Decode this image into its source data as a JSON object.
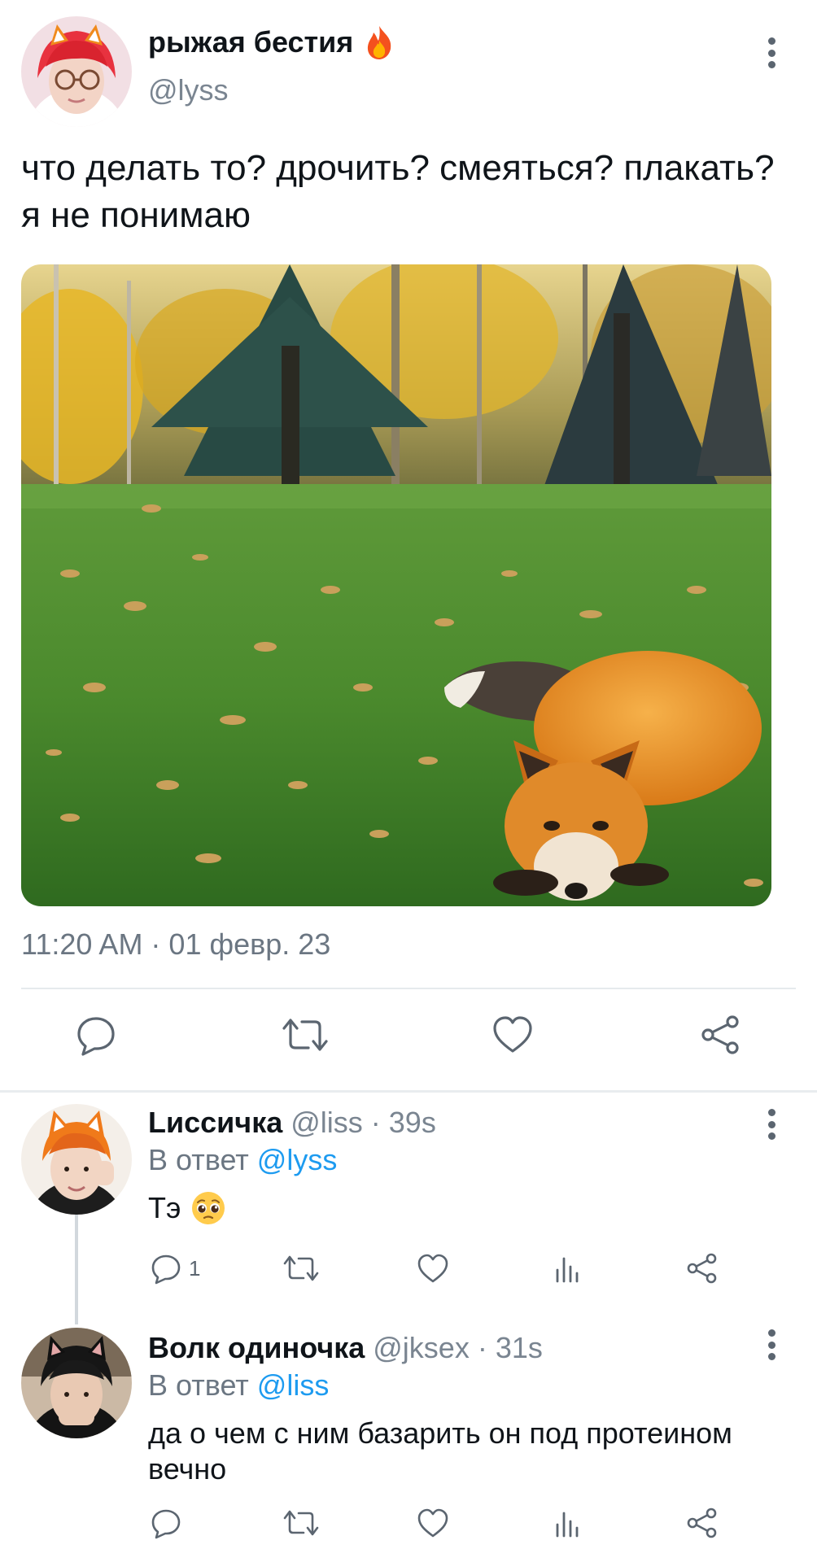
{
  "main_tweet": {
    "author_name": "рыжая бестия",
    "author_handle": "@lyss",
    "text": "что делать то? дрочить? смеяться? плакать? я не понимаю",
    "timestamp": "11:20 AM · 01 февр. 23",
    "icons": {
      "name_emoji": "fire-icon",
      "more": "more-vertical-icon",
      "reply": "reply-icon",
      "retweet": "retweet-icon",
      "like": "heart-icon",
      "share": "share-icon"
    }
  },
  "replies": [
    {
      "author_name": "Lиссичка",
      "author_handle": "@liss",
      "time": "· 39s",
      "reply_to_label": "В ответ",
      "reply_to_handle": "@lyss",
      "text": "Тэ",
      "text_emoji": "pleading-face-icon",
      "reply_count": "1"
    },
    {
      "author_name": "Волк одиночка",
      "author_handle": "@jksex",
      "time": "· 31s",
      "reply_to_label": "В ответ",
      "reply_to_handle": "@liss",
      "text": "да о чем с ним базарить он под протеином вечно",
      "reply_count": ""
    }
  ],
  "colors": {
    "text": "#0f1419",
    "secondary": "#6b7682",
    "mention": "#1d9bf0",
    "divider": "#e6eaed",
    "icon": "#5b6570"
  }
}
